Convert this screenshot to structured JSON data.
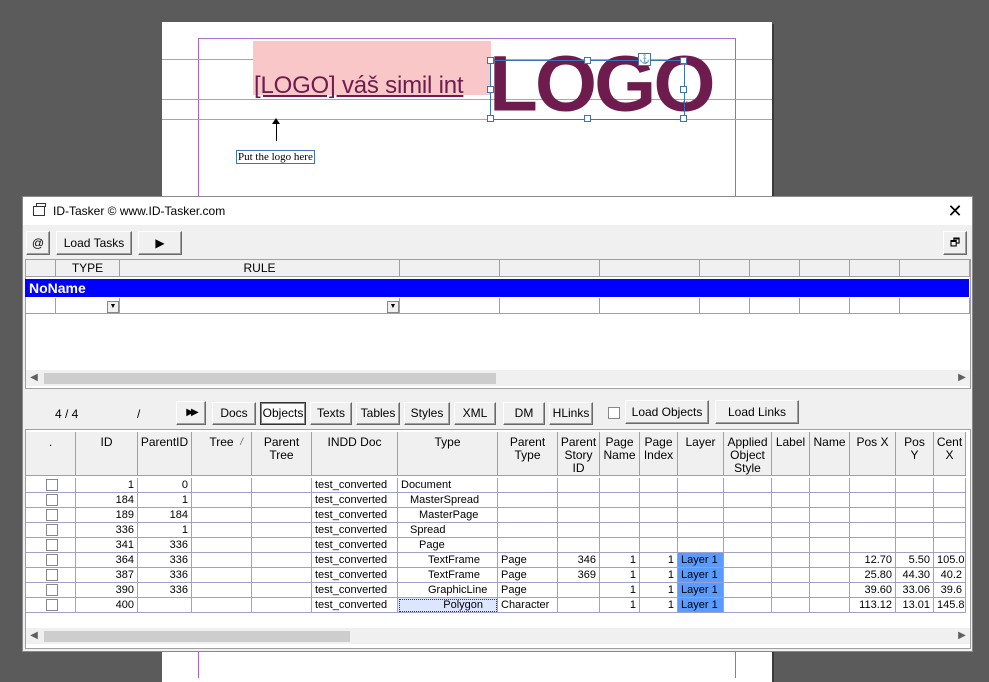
{
  "document_page": {
    "logo_placeholder_text": "[LOGO] váš simil int",
    "logo_graphic_text": "LOGO",
    "caption": "Put the logo here",
    "overset_mark": "#"
  },
  "window": {
    "title": "ID-Tasker  © www.ID-Tasker.com",
    "close_label": "✕"
  },
  "toolbar": {
    "at_label": "@",
    "load_tasks_label": "Load Tasks",
    "play_label": "▶",
    "restore_label": "🗗"
  },
  "rules_grid": {
    "headers": [
      "",
      "TYPE",
      "RULE",
      "",
      "",
      "",
      "",
      "",
      "",
      "",
      ""
    ],
    "group_name": "NoName"
  },
  "objects_toolbar": {
    "counter": "4 / 4",
    "separator": "/",
    "forward_label": "▶▶",
    "docs_label": "Docs",
    "objects_label": "Objects",
    "texts_label": "Texts",
    "tables_label": "Tables",
    "styles_label": "Styles",
    "xml_label": "XML",
    "dm_label": "DM",
    "hlinks_label": "HLinks",
    "load_objects_label": "Load Objects",
    "load_links_label": "Load Links"
  },
  "objects_grid": {
    "headers": [
      ".",
      "ID",
      "ParentID",
      "Tree",
      "Parent\nTree",
      "INDD Doc",
      "Type",
      "Parent\nType",
      "Parent\nStory\nID",
      "Page\nName",
      "Page\nIndex",
      "Layer",
      "Applied\nObject\nStyle",
      "Label",
      "Name",
      "Pos X",
      "Pos\nY",
      "Cent\nX"
    ],
    "tree_sort_mark": "/",
    "rows": [
      {
        "id": "1",
        "parent_id": "0",
        "doc": "test_converted",
        "type": "Document",
        "indent": 0,
        "parent_type": "",
        "story": "",
        "page_name": "",
        "page_index": "",
        "layer": "",
        "pos_x": "",
        "pos_y": "",
        "cent_x": ""
      },
      {
        "id": "184",
        "parent_id": "1",
        "doc": "test_converted",
        "type": "MasterSpread",
        "indent": 1,
        "parent_type": "",
        "story": "",
        "page_name": "",
        "page_index": "",
        "layer": "",
        "pos_x": "",
        "pos_y": "",
        "cent_x": ""
      },
      {
        "id": "189",
        "parent_id": "184",
        "doc": "test_converted",
        "type": "MasterPage",
        "indent": 2,
        "parent_type": "",
        "story": "",
        "page_name": "",
        "page_index": "",
        "layer": "",
        "pos_x": "",
        "pos_y": "",
        "cent_x": ""
      },
      {
        "id": "336",
        "parent_id": "1",
        "doc": "test_converted",
        "type": "Spread",
        "indent": 1,
        "parent_type": "",
        "story": "",
        "page_name": "",
        "page_index": "",
        "layer": "",
        "pos_x": "",
        "pos_y": "",
        "cent_x": ""
      },
      {
        "id": "341",
        "parent_id": "336",
        "doc": "test_converted",
        "type": "Page",
        "indent": 2,
        "parent_type": "",
        "story": "",
        "page_name": "",
        "page_index": "",
        "layer": "",
        "pos_x": "",
        "pos_y": "",
        "cent_x": ""
      },
      {
        "id": "364",
        "parent_id": "336",
        "doc": "test_converted",
        "type": "TextFrame",
        "indent": 3,
        "parent_type": "Page",
        "story": "346",
        "page_name": "1",
        "page_index": "1",
        "layer": "Layer 1",
        "pos_x": "12.70",
        "pos_y": "5.50",
        "cent_x": "105.0"
      },
      {
        "id": "387",
        "parent_id": "336",
        "doc": "test_converted",
        "type": "TextFrame",
        "indent": 3,
        "parent_type": "Page",
        "story": "369",
        "page_name": "1",
        "page_index": "1",
        "layer": "Layer 1",
        "pos_x": "25.80",
        "pos_y": "44.30",
        "cent_x": "40.2"
      },
      {
        "id": "390",
        "parent_id": "336",
        "doc": "test_converted",
        "type": "GraphicLine",
        "indent": 3,
        "parent_type": "Page",
        "story": "",
        "page_name": "1",
        "page_index": "1",
        "layer": "Layer 1",
        "pos_x": "39.60",
        "pos_y": "33.06",
        "cent_x": "39.6"
      },
      {
        "id": "400",
        "parent_id": "",
        "doc": "test_converted",
        "type": "Polygon",
        "indent": 3,
        "parent_type": "Character",
        "story": "",
        "page_name": "1",
        "page_index": "1",
        "layer": "Layer 1",
        "pos_x": "113.12",
        "pos_y": "13.01",
        "cent_x": "145.8"
      }
    ]
  },
  "colors": {
    "group_bar": "#0000ff",
    "layer_highlight": "#5a9bff",
    "logo_color": "#6e1b4e",
    "guide_cyan": "#3ad4dc"
  }
}
